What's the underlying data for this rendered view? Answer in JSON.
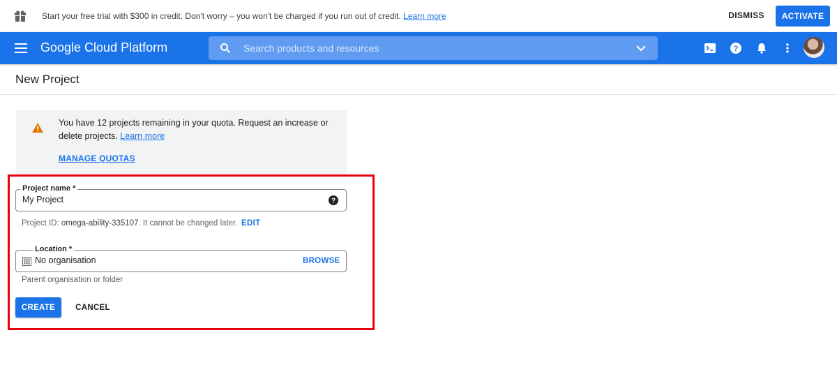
{
  "banner": {
    "message": "Start your free trial with $300 in credit. Don't worry – you won't be charged if you run out of credit.",
    "learn_more": "Learn more",
    "dismiss_label": "DISMISS",
    "activate_label": "ACTIVATE",
    "icon": "gift-icon"
  },
  "appbar": {
    "brand": "Google Cloud Platform",
    "search_placeholder": "Search products and resources",
    "icons": [
      "menu-icon",
      "search-icon",
      "chevron-down-icon",
      "cloud-shell-icon",
      "help-icon",
      "notifications-icon",
      "more-vert-icon",
      "avatar"
    ]
  },
  "page": {
    "title": "New Project"
  },
  "quota": {
    "message": "You have 12 projects remaining in your quota. Request an increase or delete projects.",
    "learn_more": "Learn more",
    "manage_label": "MANAGE QUOTAS",
    "icon": "warning-icon"
  },
  "form": {
    "project_name": {
      "label": "Project name *",
      "value": "My Project",
      "hint_prefix": "Project ID: ",
      "project_id": "omega-ability-335107",
      "hint_suffix": ". It cannot be changed later.",
      "edit_label": "EDIT"
    },
    "location": {
      "label": "Location *",
      "value": "No organisation",
      "browse_label": "BROWSE",
      "hint": "Parent organisation or folder"
    },
    "create_label": "CREATE",
    "cancel_label": "CANCEL"
  },
  "colors": {
    "primary": "#1a73e8",
    "highlight": "#e8000b",
    "warning": "#e37400"
  }
}
